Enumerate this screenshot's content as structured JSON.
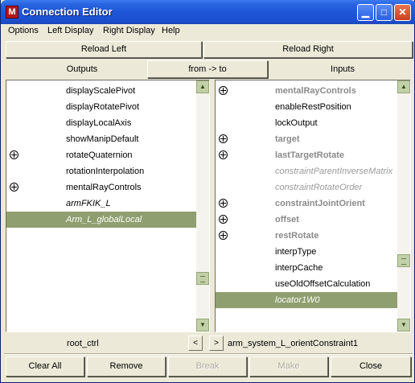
{
  "window": {
    "title": "Connection Editor",
    "app_icon": "maya-icon",
    "buttons": [
      "minimize",
      "maximize",
      "close"
    ]
  },
  "menu": [
    "Options",
    "Left Display",
    "Right Display",
    "Help"
  ],
  "reload": {
    "left": "Reload Left",
    "right": "Reload Right"
  },
  "headers": {
    "outputs": "Outputs",
    "direction": "from -> to",
    "inputs": "Inputs"
  },
  "left_list": [
    {
      "label": "displayScalePivot",
      "expand": false,
      "style": "normal"
    },
    {
      "label": "displayRotatePivot",
      "expand": false,
      "style": "normal"
    },
    {
      "label": "displayLocalAxis",
      "expand": false,
      "style": "normal"
    },
    {
      "label": "showManipDefault",
      "expand": false,
      "style": "normal"
    },
    {
      "label": "rotateQuaternion",
      "expand": true,
      "style": "normal"
    },
    {
      "label": "rotationInterpolation",
      "expand": false,
      "style": "normal"
    },
    {
      "label": "mentalRayControls",
      "expand": true,
      "style": "normal"
    },
    {
      "label": "armFKIK_L",
      "expand": false,
      "style": "italic-dark"
    },
    {
      "label": "Arm_L_globalLocal",
      "expand": false,
      "style": "italic-selected"
    }
  ],
  "right_list": [
    {
      "label": "mentalRayControls",
      "expand": true,
      "style": "bold"
    },
    {
      "label": "enableRestPosition",
      "expand": false,
      "style": "normal"
    },
    {
      "label": "lockOutput",
      "expand": false,
      "style": "normal"
    },
    {
      "label": "target",
      "expand": true,
      "style": "bold"
    },
    {
      "label": "lastTargetRotate",
      "expand": true,
      "style": "bold"
    },
    {
      "label": "constraintParentInverseMatrix",
      "expand": false,
      "style": "italic"
    },
    {
      "label": "constraintRotateOrder",
      "expand": false,
      "style": "italic"
    },
    {
      "label": "constraintJointOrient",
      "expand": true,
      "style": "bold"
    },
    {
      "label": "offset",
      "expand": true,
      "style": "bold"
    },
    {
      "label": "restRotate",
      "expand": true,
      "style": "bold"
    },
    {
      "label": "interpType",
      "expand": false,
      "style": "normal"
    },
    {
      "label": "interpCache",
      "expand": false,
      "style": "normal"
    },
    {
      "label": "useOldOffsetCalculation",
      "expand": false,
      "style": "normal"
    },
    {
      "label": "locator1W0",
      "expand": false,
      "style": "italic-selected"
    }
  ],
  "nodes": {
    "left": "root_ctrl",
    "prev": "<",
    "next": ">",
    "right": "arm_system_L_orientConstraint1"
  },
  "actions": {
    "clear_all": "Clear All",
    "remove": "Remove",
    "break": "Break",
    "make": "Make",
    "close": "Close"
  }
}
